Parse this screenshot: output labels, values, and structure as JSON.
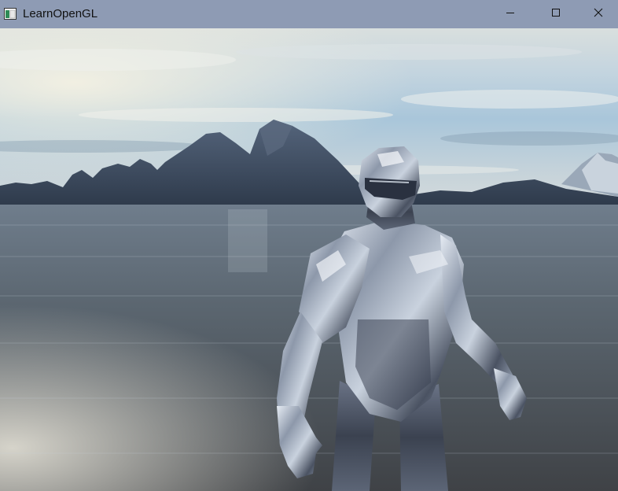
{
  "window": {
    "title": "LearnOpenGL",
    "icon": "opengl-window-icon",
    "controls": {
      "minimize": "minimize-icon",
      "maximize": "maximize-icon",
      "close": "close-icon"
    },
    "titlebar_color": "#8e9bb4"
  },
  "scene": {
    "description_icons": [
      "skybox",
      "mountains",
      "water",
      "chrome-character-model"
    ],
    "sky_color": "#b9cfe0",
    "water_color": "#5b6670",
    "mountain_color": "#3d4a5e",
    "model_color": "#aab4c4"
  }
}
